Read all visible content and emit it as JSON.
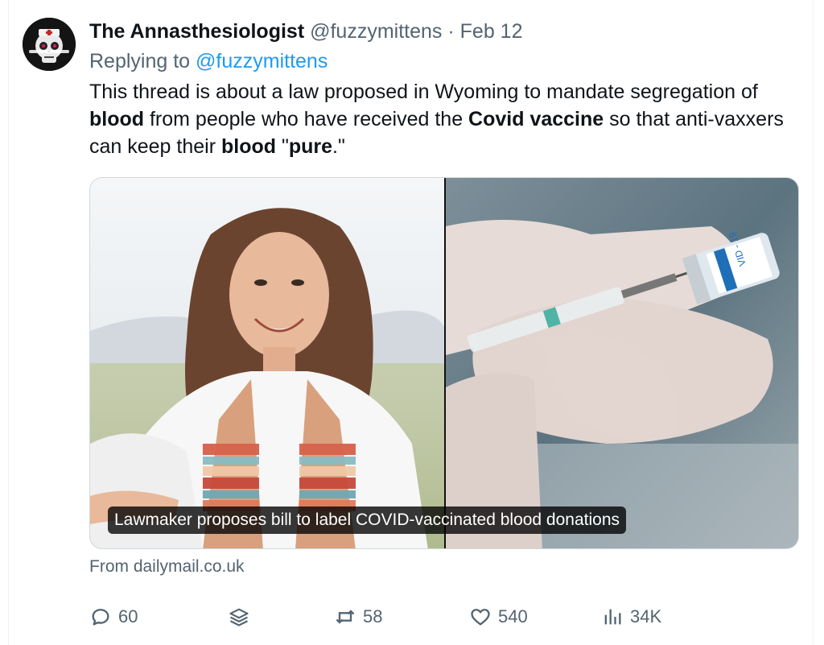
{
  "tweet": {
    "display_name": "The Annasthesiologist",
    "handle": "@fuzzymittens",
    "separator": "·",
    "date": "Feb 12",
    "replying_prefix": "Replying to",
    "replying_handle": "@fuzzymittens",
    "text": {
      "t1": "This thread is about a law proposed in Wyoming to mandate segregation of ",
      "b1": "blood",
      "t2": " from people who have received the ",
      "b2": "Covid vaccine",
      "t3": " so that anti-vaxxers can keep their ",
      "b3": "blood",
      "t4": " \"",
      "b4": "pure",
      "t5": ".\""
    },
    "media": {
      "caption": "Lawmaker proposes bill to label COVID-vaccinated blood donations",
      "vial_label": "VID - 19"
    },
    "source": "From dailymail.co.uk"
  },
  "actions": {
    "replies": "60",
    "retweets": "58",
    "likes": "540",
    "views": "34K"
  },
  "colors": {
    "text": "#0f1419",
    "secondary": "#536471",
    "link": "#1d9bf0"
  },
  "icons": [
    "avatar-skull-icon",
    "reply-icon",
    "layers-icon",
    "retweet-icon",
    "like-icon",
    "views-icon"
  ]
}
